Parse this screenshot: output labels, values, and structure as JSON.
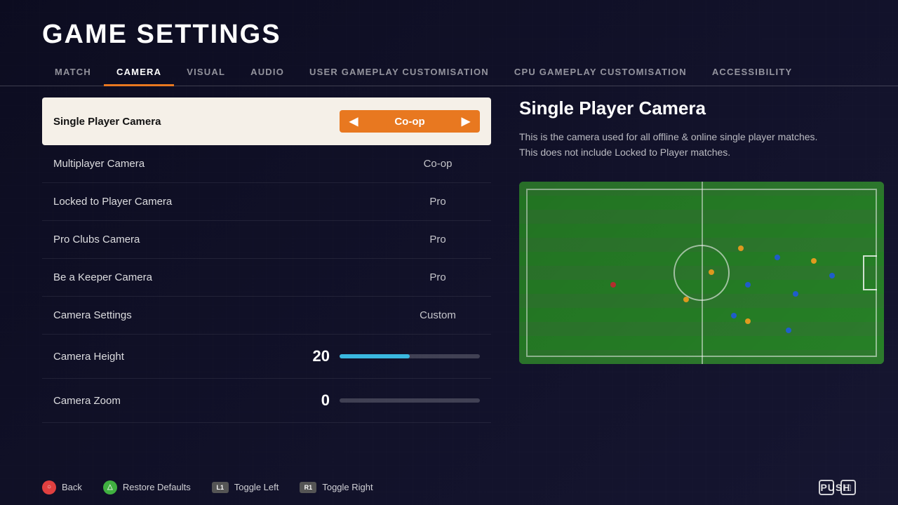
{
  "page": {
    "title": "GAME SETTINGS",
    "background_color": "#1a1a2e"
  },
  "tabs": [
    {
      "id": "match",
      "label": "MATCH",
      "active": false
    },
    {
      "id": "camera",
      "label": "CAMERA",
      "active": true
    },
    {
      "id": "visual",
      "label": "VISUAL",
      "active": false
    },
    {
      "id": "audio",
      "label": "AUDIO",
      "active": false
    },
    {
      "id": "user-gameplay",
      "label": "USER GAMEPLAY CUSTOMISATION",
      "active": false
    },
    {
      "id": "cpu-gameplay",
      "label": "CPU GAMEPLAY CUSTOMISATION",
      "active": false
    },
    {
      "id": "accessibility",
      "label": "ACCESSIBILITY",
      "active": false
    }
  ],
  "settings": [
    {
      "id": "single-player-camera",
      "label": "Single Player Camera",
      "value": "Co-op",
      "active": true,
      "type": "select"
    },
    {
      "id": "multiplayer-camera",
      "label": "Multiplayer Camera",
      "value": "Co-op",
      "active": false,
      "type": "select"
    },
    {
      "id": "locked-to-player-camera",
      "label": "Locked to Player Camera",
      "value": "Pro",
      "active": false,
      "type": "select"
    },
    {
      "id": "pro-clubs-camera",
      "label": "Pro Clubs Camera",
      "value": "Pro",
      "active": false,
      "type": "select"
    },
    {
      "id": "be-a-keeper-camera",
      "label": "Be a Keeper Camera",
      "value": "Pro",
      "active": false,
      "type": "select"
    },
    {
      "id": "camera-settings",
      "label": "Camera Settings",
      "value": "Custom",
      "active": false,
      "type": "select"
    },
    {
      "id": "camera-height",
      "label": "Camera Height",
      "value": "20",
      "fill_percent": 50,
      "active": false,
      "type": "slider",
      "color": "blue"
    },
    {
      "id": "camera-zoom",
      "label": "Camera Zoom",
      "value": "0",
      "fill_percent": 0,
      "active": false,
      "type": "slider",
      "color": "gray"
    }
  ],
  "info_panel": {
    "title": "Single Player Camera",
    "description": "This is the camera used for all offline & online single player matches.\nThis does not include Locked to Player matches."
  },
  "footer": {
    "actions": [
      {
        "id": "back",
        "button_type": "circle",
        "button_label": "○",
        "label": "Back"
      },
      {
        "id": "restore-defaults",
        "button_type": "triangle",
        "button_label": "△",
        "label": "Restore Defaults"
      },
      {
        "id": "toggle-left",
        "button_type": "l1",
        "button_label": "L1",
        "label": "Toggle Left"
      },
      {
        "id": "toggle-right",
        "button_type": "r1",
        "button_label": "R1",
        "label": "Toggle Right"
      }
    ],
    "logo": "PUSH"
  },
  "accent_color": "#e87820",
  "slider_color": "#3ab8e0"
}
